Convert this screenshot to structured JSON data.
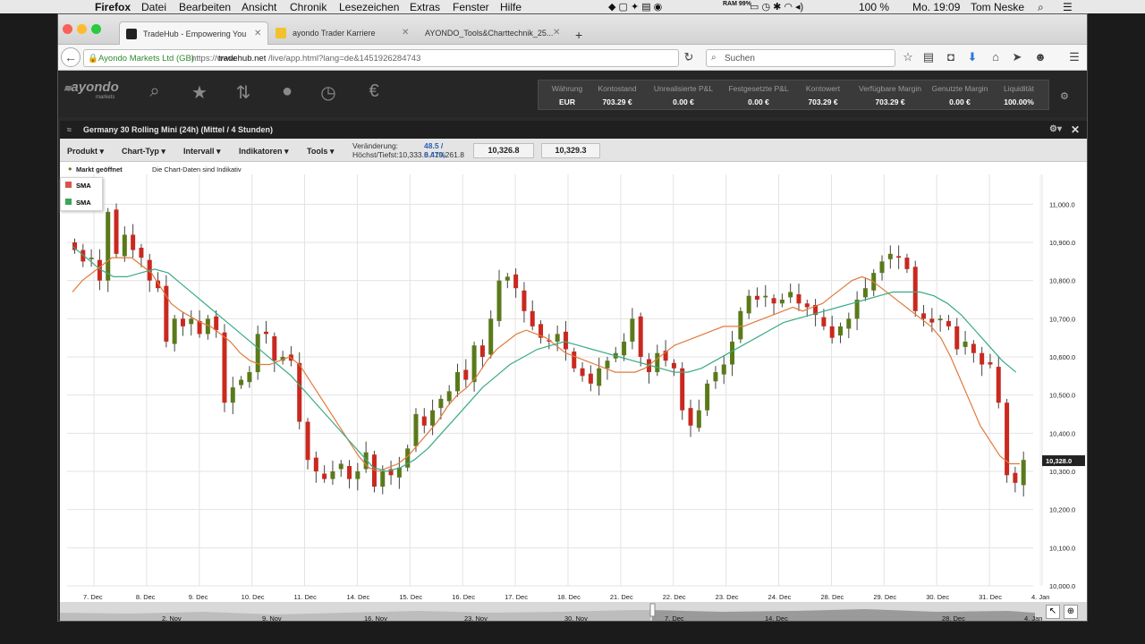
{
  "menubar": {
    "app_name": "Firefox",
    "items": [
      "Datei",
      "Bearbeiten",
      "Ansicht",
      "Chronik",
      "Lesezeichen",
      "Extras",
      "Fenster",
      "Hilfe"
    ],
    "ram": "RAM 99%",
    "battery": "100 %",
    "clock": "Mo. 19:09",
    "user": "Tom Neske"
  },
  "browser": {
    "tabs": [
      {
        "title": "TradeHub - Empowering You",
        "active": true
      },
      {
        "title": "ayondo Trader Karriere",
        "active": false
      },
      {
        "title": "AYONDO_Tools&Charttechnik_25...",
        "active": false
      }
    ],
    "new_tab": "+",
    "site_identity": "Ayondo Markets Ltd (GB)",
    "url_prefix": "https://www.",
    "url_domain": "tradehub.net",
    "url_path": "/live/app.html?lang=de&1451926284743",
    "search_placeholder": "Suchen"
  },
  "app": {
    "logo": "ayondo",
    "logo_sub": "markets",
    "account": [
      {
        "label": "Währung",
        "value": "EUR"
      },
      {
        "label": "Kontostand",
        "value": "703.29 €"
      },
      {
        "label": "Unrealisierte P&L",
        "value": "0.00 €"
      },
      {
        "label": "Festgesetzte P&L",
        "value": "0.00 €"
      },
      {
        "label": "Kontowert",
        "value": "703.29 €"
      },
      {
        "label": "Verfügbare Margin",
        "value": "703.29 €"
      },
      {
        "label": "Genutzte Margin",
        "value": "0.00 €"
      },
      {
        "label": "Liquidität",
        "value": "100.00%"
      }
    ]
  },
  "panel": {
    "title": "Germany 30 Rolling Mini (24h) (Mittel / 4 Stunden)",
    "toolbar": [
      "Produkt",
      "Chart-Typ",
      "Intervall",
      "Indikatoren",
      "Tools"
    ],
    "change_label": "Veränderung:",
    "change_value": "48.5 / 0.47%",
    "hilo_label": "Höchst/Tiefst:",
    "hilo_value": "10,333.8 / 10,261.8",
    "sell_price": "10,326.8",
    "buy_price": "10,329.3",
    "market_status": "Markt geöffnet",
    "chart_note": "Die Chart-Daten sind Indikativ",
    "legend": [
      {
        "name": "SMA",
        "color": "#d9534f"
      },
      {
        "name": "SMA",
        "color": "#3aa757"
      }
    ]
  },
  "navigator": {
    "labels": [
      "2. Nov",
      "9. Nov",
      "16. Nov",
      "23. Nov",
      "30. Nov",
      "7. Dec",
      "14. Dec",
      "28. Dec",
      "4. Jan"
    ]
  },
  "chart_data": {
    "type": "candlestick",
    "ylim": [
      10000,
      11050
    ],
    "yticks": [
      "11,000.0",
      "10,900.0",
      "10,800.0",
      "10,700.0",
      "10,600.0",
      "10,500.0",
      "10,400.0",
      "10,300.0",
      "10,200.0",
      "10,100.0",
      "10,000.0"
    ],
    "xlabels": [
      "7. Dec",
      "8. Dec",
      "9. Dec",
      "10. Dec",
      "11. Dec",
      "14. Dec",
      "15. Dec",
      "16. Dec",
      "17. Dec",
      "18. Dec",
      "21. Dec",
      "22. Dec",
      "23. Dec",
      "24. Dec",
      "28. Dec",
      "29. Dec",
      "30. Dec",
      "31. Dec",
      "4. Jan"
    ],
    "last_price": "10,328.0",
    "colors": {
      "up": "#5a7a1a",
      "down": "#c9291f",
      "sma_fast": "#e07a3c",
      "sma_slow": "#3aaa86"
    },
    "closes": [
      10880,
      10850,
      10860,
      10800,
      10980,
      10870,
      10920,
      10880,
      10860,
      10800,
      10780,
      10640,
      10700,
      10680,
      10700,
      10660,
      10700,
      10670,
      10480,
      10520,
      10540,
      10560,
      10660,
      10660,
      10590,
      10600,
      10590,
      10430,
      10330,
      10300,
      10280,
      10300,
      10320,
      10280,
      10300,
      10350,
      10260,
      10300,
      10290,
      10310,
      10360,
      10450,
      10420,
      10460,
      10490,
      10510,
      10560,
      10540,
      10630,
      10600,
      10700,
      10800,
      10810,
      10780,
      10720,
      10680,
      10650,
      10640,
      10660,
      10620,
      10570,
      10550,
      10530,
      10570,
      10590,
      10610,
      10640,
      10700,
      10600,
      10560,
      10610,
      10590,
      10570,
      10460,
      10420,
      10460,
      10530,
      10560,
      10580,
      10640,
      10720,
      10760,
      10750,
      10760,
      10740,
      10750,
      10770,
      10740,
      10730,
      10710,
      10680,
      10650,
      10680,
      10700,
      10750,
      10780,
      10820,
      10850,
      10870,
      10860,
      10830,
      10720,
      10700,
      10690,
      10700,
      10680,
      10620,
      10640,
      10610,
      10580,
      10580,
      10480,
      10290,
      10270,
      10330
    ],
    "sma_fast": [
      10770,
      10800,
      10820,
      10840,
      10860,
      10860,
      10860,
      10840,
      10820,
      10780,
      10740,
      10720,
      10705,
      10690,
      10680,
      10660,
      10640,
      10610,
      10590,
      10580,
      10580,
      10590,
      10600,
      10580,
      10540,
      10500,
      10460,
      10420,
      10380,
      10340,
      10310,
      10300,
      10310,
      10320,
      10340,
      10370,
      10400,
      10430,
      10470,
      10500,
      10520,
      10550,
      10590,
      10620,
      10640,
      10660,
      10670,
      10660,
      10650,
      10630,
      10610,
      10600,
      10590,
      10580,
      10570,
      10560,
      10560,
      10560,
      10570,
      10590,
      10610,
      10630,
      10640,
      10650,
      10660,
      10670,
      10680,
      10680,
      10680,
      10690,
      10700,
      10710,
      10720,
      10730,
      10720,
      10730,
      10740,
      10760,
      10780,
      10800,
      10810,
      10800,
      10780,
      10760,
      10740,
      10720,
      10700,
      10680,
      10650,
      10600,
      10540,
      10480,
      10420,
      10380,
      10340,
      10320,
      10320
    ],
    "sma_slow": [
      10890,
      10860,
      10830,
      10810,
      10810,
      10820,
      10830,
      10820,
      10790,
      10760,
      10730,
      10700,
      10670,
      10640,
      10610,
      10580,
      10550,
      10510,
      10470,
      10430,
      10390,
      10350,
      10310,
      10300,
      10310,
      10330,
      10360,
      10400,
      10440,
      10480,
      10520,
      10550,
      10580,
      10600,
      10620,
      10630,
      10640,
      10630,
      10620,
      10610,
      10600,
      10590,
      10580,
      10570,
      10560,
      10560,
      10570,
      10590,
      10610,
      10630,
      10650,
      10670,
      10690,
      10700,
      10710,
      10720,
      10730,
      10740,
      10750,
      10760,
      10770,
      10770,
      10770,
      10760,
      10740,
      10710,
      10670,
      10630,
      10590,
      10560
    ]
  }
}
